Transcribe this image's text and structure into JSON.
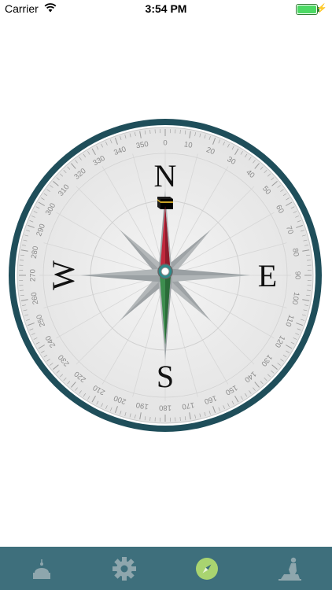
{
  "status_bar": {
    "carrier": "Carrier",
    "time": "3:54 PM",
    "battery_icon": "battery-charging-icon",
    "wifi_icon": "wifi-icon"
  },
  "compass": {
    "cardinals": {
      "north": "N",
      "east": "E",
      "south": "S",
      "west": "W"
    },
    "degree_labels": [
      "0",
      "10",
      "20",
      "30",
      "40",
      "50",
      "60",
      "70",
      "80",
      "90",
      "100",
      "110",
      "120",
      "130",
      "140",
      "150",
      "160",
      "170",
      "180",
      "190",
      "200",
      "210",
      "220",
      "230",
      "240",
      "250",
      "260",
      "270",
      "280",
      "290",
      "300",
      "310",
      "320",
      "330",
      "340",
      "350"
    ],
    "qibla_marker_icon": "kaaba-icon",
    "colors": {
      "bezel": "#1f4e5a",
      "needle_north": "#c0283c",
      "needle_south": "#3d8d4e",
      "dial_face": "#ededed",
      "rose": "#a9aeb0"
    }
  },
  "tab_bar": {
    "background": "#3e6f7c",
    "active_color": "#a9d470",
    "tabs": [
      {
        "icon": "mosque-icon",
        "active": false
      },
      {
        "icon": "gear-icon",
        "active": false
      },
      {
        "icon": "compass-icon",
        "active": true
      },
      {
        "icon": "prayer-icon",
        "active": false
      }
    ]
  }
}
